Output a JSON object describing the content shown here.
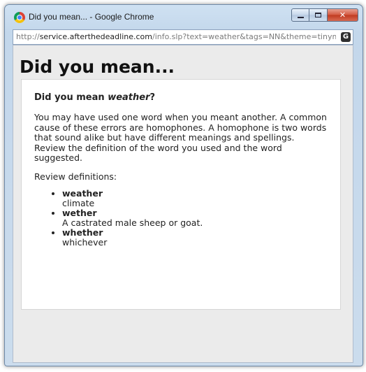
{
  "window": {
    "title": "Did you mean... - Google Chrome",
    "controls": {
      "minimize": "",
      "maximize": "",
      "close": "✕"
    }
  },
  "address_bar": {
    "scheme": "http://",
    "host": "service.afterthedeadline.com",
    "path": "/info.slp?text=weather&tags=NN&theme=tinymce",
    "extension_icon": "G"
  },
  "page": {
    "heading": "Did you mean...",
    "question_prefix": "Did you mean ",
    "question_word": "weather",
    "question_suffix": "?",
    "explanation": "You may have used one word when you meant another. A common cause of these errors are homophones. A homophone is two words that sound alike but have different meanings and spellings. Review the definition of the word you used and the word suggested.",
    "review_label": "Review definitions:",
    "definitions": [
      {
        "word": "weather",
        "meaning": "climate"
      },
      {
        "word": "wether",
        "meaning": "A castrated male sheep or goat."
      },
      {
        "word": "whether",
        "meaning": "whichever"
      }
    ]
  },
  "icons": {
    "app": "chrome-logo-icon",
    "extension": "after-the-deadline-icon"
  }
}
